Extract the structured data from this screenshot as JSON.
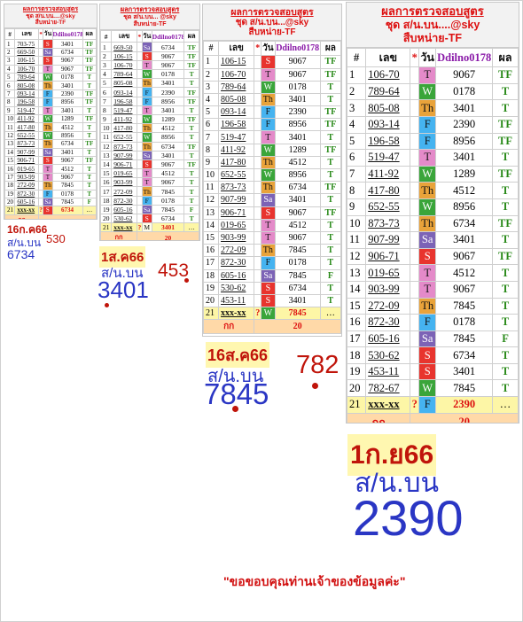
{
  "panels": [
    {
      "title": "ผลการตรวจสอบสูตร",
      "line2": "ชุด ส/น.บน....@sky",
      "line3": "สืบหน่าย-TF",
      "header": [
        "#",
        "เลข",
        "*",
        "วัน",
        "Ddilno0178",
        "ผล"
      ],
      "rows": [
        [
          "1",
          "703-75",
          "S",
          "3401",
          "TF"
        ],
        [
          "2",
          "669-50",
          "Sa",
          "6734",
          "TF"
        ],
        [
          "3",
          "106-15",
          "S",
          "9067",
          "TF"
        ],
        [
          "4",
          "106-70",
          "T",
          "9067",
          "TF"
        ],
        [
          "5",
          "789-64",
          "W",
          "0178",
          "T"
        ],
        [
          "6",
          "805-08",
          "Th",
          "3401",
          "T"
        ],
        [
          "7",
          "093-14",
          "F",
          "2390",
          "TF"
        ],
        [
          "8",
          "196-58",
          "F",
          "8956",
          "TF"
        ],
        [
          "9",
          "519-47",
          "T",
          "3401",
          "T"
        ],
        [
          "10",
          "411-92",
          "W",
          "1289",
          "TF"
        ],
        [
          "11",
          "417-80",
          "Th",
          "4512",
          "T"
        ],
        [
          "12",
          "652-55",
          "W",
          "8956",
          "T"
        ],
        [
          "13",
          "873-73",
          "Th",
          "6734",
          "TF"
        ],
        [
          "14",
          "907-99",
          "Sa",
          "3401",
          "T"
        ],
        [
          "15",
          "906-71",
          "S",
          "9067",
          "TF"
        ],
        [
          "16",
          "019-65",
          "T",
          "4512",
          "T"
        ],
        [
          "17",
          "903-99",
          "T",
          "9067",
          "T"
        ],
        [
          "18",
          "272-09",
          "Th",
          "7845",
          "T"
        ],
        [
          "19",
          "872-30",
          "F",
          "0178",
          "T"
        ],
        [
          "20",
          "605-16",
          "Sa",
          "7845",
          "F"
        ],
        [
          "21",
          "xxx-xx",
          "?",
          "S",
          "6734"
        ]
      ],
      "sum": "กก",
      "date": "16ก.ค66",
      "label": "ส/น.บน",
      "number": "6734",
      "side": "530"
    },
    {
      "title": "ผลการตรวจสอบสูตร",
      "line2": "ชุด ส/น.บน... @sky",
      "line3": "สืบหน่าย-TF",
      "header": [
        "#",
        "เลข",
        "*",
        "วัน",
        "Ddilno0178",
        "ผล"
      ],
      "rows": [
        [
          "1",
          "669-50",
          "Sa",
          "6734",
          "TF"
        ],
        [
          "2",
          "106-15",
          "S",
          "9067",
          "TF"
        ],
        [
          "3",
          "106-70",
          "T",
          "9067",
          "TF"
        ],
        [
          "4",
          "789-64",
          "W",
          "0178",
          "T"
        ],
        [
          "5",
          "805-08",
          "Th",
          "3401",
          "T"
        ],
        [
          "6",
          "093-14",
          "F",
          "2390",
          "TF"
        ],
        [
          "7",
          "196-58",
          "F",
          "8956",
          "TF"
        ],
        [
          "8",
          "519-47",
          "T",
          "3401",
          "T"
        ],
        [
          "9",
          "411-92",
          "W",
          "1289",
          "TF"
        ],
        [
          "10",
          "417-80",
          "Th",
          "4512",
          "T"
        ],
        [
          "11",
          "652-55",
          "W",
          "8956",
          "T"
        ],
        [
          "12",
          "873-73",
          "Th",
          "6734",
          "TF"
        ],
        [
          "13",
          "907-99",
          "Sa",
          "3401",
          "T"
        ],
        [
          "14",
          "906-71",
          "S",
          "9067",
          "TF"
        ],
        [
          "15",
          "019-65",
          "T",
          "4512",
          "T"
        ],
        [
          "16",
          "903-99",
          "T",
          "9067",
          "T"
        ],
        [
          "17",
          "272-09",
          "Th",
          "7845",
          "T"
        ],
        [
          "18",
          "872-30",
          "F",
          "0178",
          "T"
        ],
        [
          "19",
          "605-16",
          "Sa",
          "7845",
          "F"
        ],
        [
          "20",
          "530-62",
          "S",
          "6734",
          "T"
        ],
        [
          "21",
          "xxx-xx",
          "?",
          "M",
          "3401"
        ]
      ],
      "sum": "กก",
      "sumval": "20",
      "date": "1ส.ค66",
      "label": "ส/น.บน",
      "number": "3401",
      "side": "453"
    },
    {
      "title": "ผลการตรวจสอบสูตร",
      "line2": "ชุด ส/น.บน...@sky",
      "line3": "สืบหน่าย-TF",
      "header": [
        "#",
        "เลข",
        "*",
        "วัน",
        "Ddilno0178",
        "ผล"
      ],
      "rows": [
        [
          "1",
          "106-15",
          "S",
          "9067",
          "TF"
        ],
        [
          "2",
          "106-70",
          "T",
          "9067",
          "TF"
        ],
        [
          "3",
          "789-64",
          "W",
          "0178",
          "T"
        ],
        [
          "4",
          "805-08",
          "Th",
          "3401",
          "T"
        ],
        [
          "5",
          "093-14",
          "F",
          "2390",
          "TF"
        ],
        [
          "6",
          "196-58",
          "F",
          "8956",
          "TF"
        ],
        [
          "7",
          "519-47",
          "T",
          "3401",
          "T"
        ],
        [
          "8",
          "411-92",
          "W",
          "1289",
          "TF"
        ],
        [
          "9",
          "417-80",
          "Th",
          "4512",
          "T"
        ],
        [
          "10",
          "652-55",
          "W",
          "8956",
          "T"
        ],
        [
          "11",
          "873-73",
          "Th",
          "6734",
          "TF"
        ],
        [
          "12",
          "907-99",
          "Sa",
          "3401",
          "T"
        ],
        [
          "13",
          "906-71",
          "S",
          "9067",
          "TF"
        ],
        [
          "14",
          "019-65",
          "T",
          "4512",
          "T"
        ],
        [
          "15",
          "903-99",
          "T",
          "9067",
          "T"
        ],
        [
          "16",
          "272-09",
          "Th",
          "7845",
          "T"
        ],
        [
          "17",
          "872-30",
          "F",
          "0178",
          "T"
        ],
        [
          "18",
          "605-16",
          "Sa",
          "7845",
          "F"
        ],
        [
          "19",
          "530-62",
          "S",
          "6734",
          "T"
        ],
        [
          "20",
          "453-11",
          "S",
          "3401",
          "T"
        ],
        [
          "21",
          "xxx-xx",
          "?",
          "W",
          "7845"
        ]
      ],
      "sum": "กก",
      "sumval": "20",
      "date": "16ส.ค66",
      "label": "ส/น.บน",
      "number": "7845",
      "side": "782"
    },
    {
      "title": "ผลการตรวจสอบสูตร",
      "line2": "ชุด ส/น.บน....@sky",
      "line3": "สืบหน่าย-TF",
      "header": [
        "#",
        "เลข",
        "*",
        "วัน",
        "Ddilno0178",
        "ผล"
      ],
      "rows": [
        [
          "1",
          "106-70",
          "T",
          "9067",
          "TF"
        ],
        [
          "2",
          "789-64",
          "W",
          "0178",
          "T"
        ],
        [
          "3",
          "805-08",
          "Th",
          "3401",
          "T"
        ],
        [
          "4",
          "093-14",
          "F",
          "2390",
          "TF"
        ],
        [
          "5",
          "196-58",
          "F",
          "8956",
          "TF"
        ],
        [
          "6",
          "519-47",
          "T",
          "3401",
          "T"
        ],
        [
          "7",
          "411-92",
          "W",
          "1289",
          "TF"
        ],
        [
          "8",
          "417-80",
          "Th",
          "4512",
          "T"
        ],
        [
          "9",
          "652-55",
          "W",
          "8956",
          "T"
        ],
        [
          "10",
          "873-73",
          "Th",
          "6734",
          "TF"
        ],
        [
          "11",
          "907-99",
          "Sa",
          "3401",
          "T"
        ],
        [
          "12",
          "906-71",
          "S",
          "9067",
          "TF"
        ],
        [
          "13",
          "019-65",
          "T",
          "4512",
          "T"
        ],
        [
          "14",
          "903-99",
          "T",
          "9067",
          "T"
        ],
        [
          "15",
          "272-09",
          "Th",
          "7845",
          "T"
        ],
        [
          "16",
          "872-30",
          "F",
          "0178",
          "T"
        ],
        [
          "17",
          "605-16",
          "Sa",
          "7845",
          "F"
        ],
        [
          "18",
          "530-62",
          "S",
          "6734",
          "T"
        ],
        [
          "19",
          "453-11",
          "S",
          "3401",
          "T"
        ],
        [
          "20",
          "782-67",
          "W",
          "7845",
          "T"
        ],
        [
          "21",
          "xxx-xx",
          "?",
          "F",
          "2390"
        ]
      ],
      "sum": "กก",
      "sumval": "20",
      "date": "1ก.ย66",
      "label": "ส/น.บน",
      "number": "2390"
    }
  ],
  "thanks": "\"ขอขอบคุณท่านเจ้าของข้อมูลค่ะ\"",
  "colors": {
    "accent_red": "#d11111",
    "number_blue": "#2a36c4",
    "tf_green": "#2a8a1a"
  }
}
